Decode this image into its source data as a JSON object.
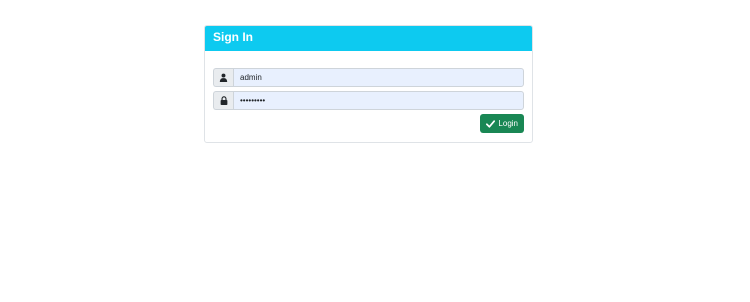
{
  "card": {
    "title": "Sign In"
  },
  "form": {
    "username_value": "admin",
    "password_value": "•••••••••",
    "username_icon": "user-icon",
    "password_icon": "lock-icon"
  },
  "actions": {
    "login_label": "Login",
    "login_icon": "check-icon"
  },
  "colors": {
    "header": "#0dcaf0",
    "login_button": "#198754",
    "input_background": "#e8f0fe"
  }
}
